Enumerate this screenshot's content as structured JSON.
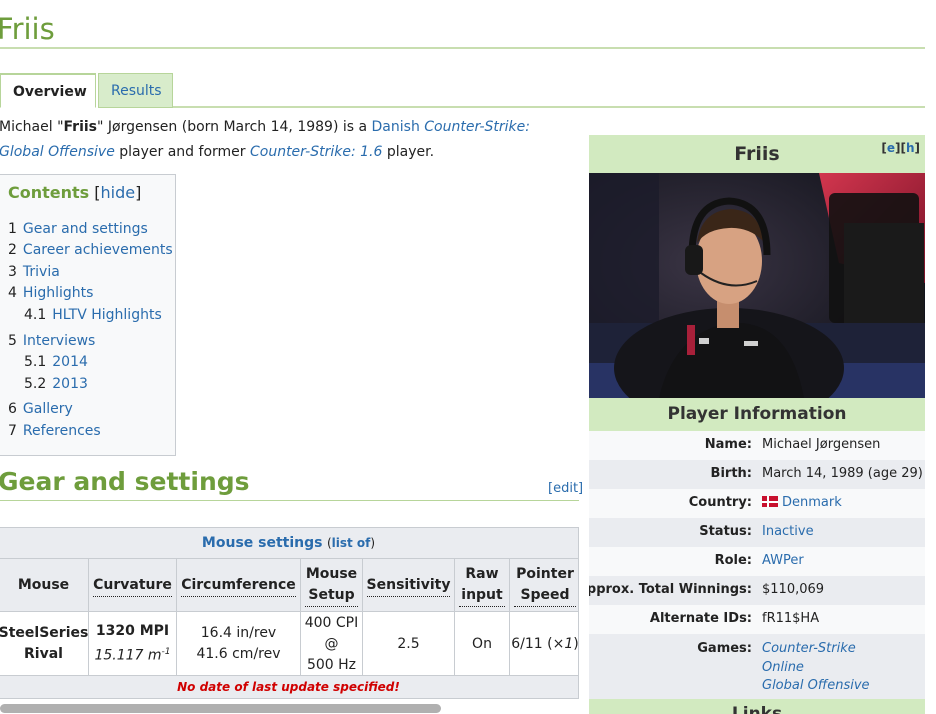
{
  "page": {
    "title": "Friis"
  },
  "tabs": [
    {
      "label": "Overview",
      "active": true
    },
    {
      "label": "Results",
      "active": false
    }
  ],
  "intro": {
    "pre": "Michael \"",
    "nick": "Friis",
    "mid": "\" Jørgensen (born March 14, 1989) is a ",
    "link_danish": "Danish",
    "link_csgo": "Counter-Strike: Global Offensive",
    "mid2": " player and former ",
    "link_cs16": "Counter-Strike: 1.6",
    "end": " player."
  },
  "toc": {
    "title": "Contents",
    "hide_label": "hide",
    "items": [
      {
        "num": "1",
        "label": "Gear and settings"
      },
      {
        "num": "2",
        "label": "Career achievements"
      },
      {
        "num": "3",
        "label": "Trivia"
      },
      {
        "num": "4",
        "label": "Highlights"
      },
      {
        "num": "4.1",
        "label": "HLTV Highlights"
      },
      {
        "num": "5",
        "label": "Interviews"
      },
      {
        "num": "5.1",
        "label": "2014"
      },
      {
        "num": "5.2",
        "label": "2013"
      },
      {
        "num": "6",
        "label": "Gallery"
      },
      {
        "num": "7",
        "label": "References"
      }
    ]
  },
  "section": {
    "heading": "Gear and settings",
    "edit_label": "edit"
  },
  "mouse_table": {
    "caption": "Mouse settings",
    "caption_link": "list of",
    "headers": [
      "Mouse",
      "Curvature",
      "Circumference",
      "Mouse Setup",
      "Sensitivity",
      "Raw input",
      "Pointer Speed"
    ],
    "row": {
      "mouse": "SteelSeries Rival",
      "curvature_main": "1320 MPI",
      "curvature_sub": "15.117 m",
      "curvature_exp": "-1",
      "circumference_1": "16.4 in/rev",
      "circumference_2": "41.6 cm/rev",
      "setup_1": "400 CPI",
      "setup_2": "@",
      "setup_3": "500 Hz",
      "sensitivity": "2.5",
      "raw_input": "On",
      "pointer_speed": "6/11 (×",
      "pointer_mult": "1",
      "pointer_close": ")"
    },
    "footer": "No date of last update specified!"
  },
  "infobox": {
    "title": "Friis",
    "edit_e": "e",
    "edit_h": "h",
    "section": "Player Information",
    "fields": [
      {
        "label": "Name:",
        "value": "Michael Jørgensen"
      },
      {
        "label": "Birth:",
        "value": "March 14, 1989 (age 29)"
      },
      {
        "label": "Country:",
        "value": "Denmark"
      },
      {
        "label": "Status:",
        "value": "Inactive"
      },
      {
        "label": "Role:",
        "value": "AWPer"
      },
      {
        "label": "Approx. Total Winnings:",
        "value": "$110,069"
      },
      {
        "label": "Alternate IDs:",
        "value": "fR11$HA"
      },
      {
        "label": "Games:",
        "values": [
          "Counter-Strike",
          "Online",
          "Global Offensive"
        ]
      }
    ],
    "links_heading": "Links"
  },
  "colors": {
    "accent_green": "#6e9d3c",
    "header_green": "#d2eac0",
    "link": "#2a6cad",
    "warning": "#d00000"
  }
}
